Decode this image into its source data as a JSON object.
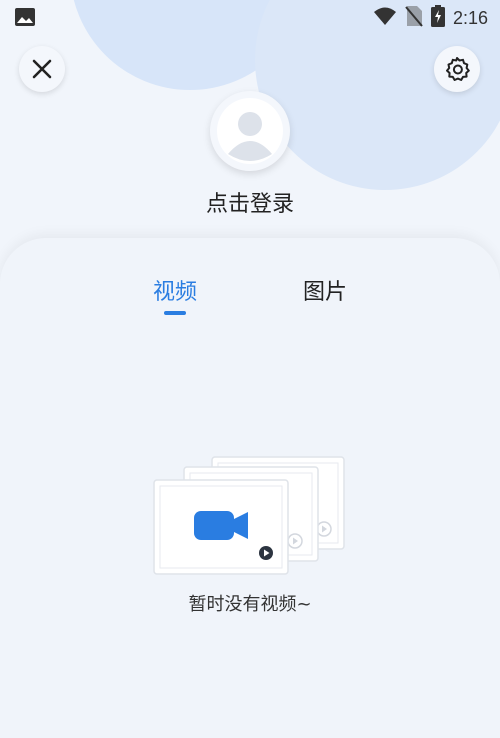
{
  "status_bar": {
    "time": "2:16",
    "icons": [
      "image-icon",
      "wifi-icon",
      "no-sim-icon",
      "battery-charging-icon"
    ]
  },
  "header": {
    "close_icon": "close-icon",
    "settings_icon": "gear-icon",
    "avatar_icon": "user-avatar-icon",
    "login_label": "点击登录"
  },
  "tabs": [
    {
      "label": "视频",
      "active": true
    },
    {
      "label": "图片",
      "active": false
    }
  ],
  "empty_state": {
    "message": "暂时没有视频~",
    "icon": "video-camera-icon"
  },
  "colors": {
    "accent": "#2a7de1",
    "background": "#f1f5fb"
  }
}
